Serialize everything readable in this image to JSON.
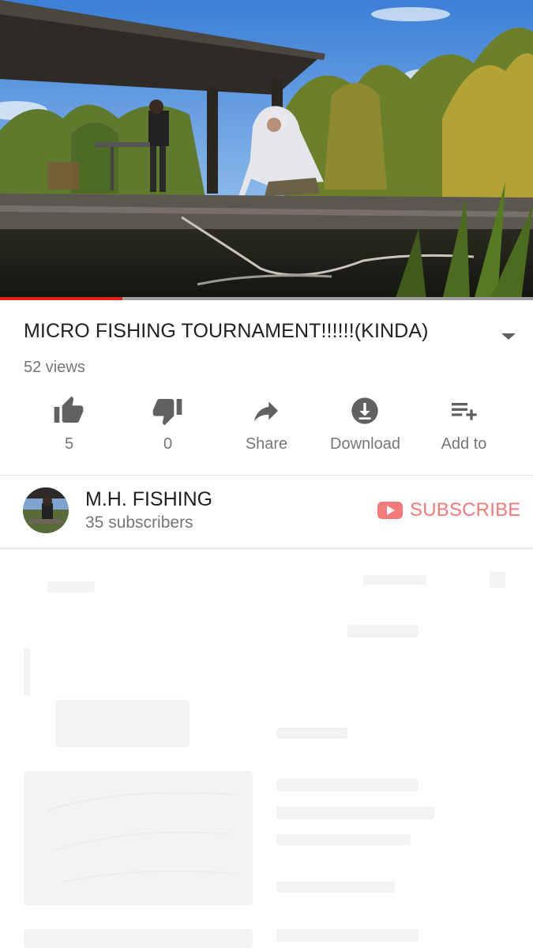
{
  "video": {
    "title": "MICRO FISHING TOURNAMENT!!!!!!(KINDA)",
    "views": "52 views",
    "progress": 0.23
  },
  "actions": [
    {
      "name": "like",
      "icon": "thumbs-up-icon",
      "label": "5"
    },
    {
      "name": "dislike",
      "icon": "thumbs-down-icon",
      "label": "0"
    },
    {
      "name": "share",
      "icon": "share-arrow-icon",
      "label": "Share"
    },
    {
      "name": "download",
      "icon": "download-icon",
      "label": "Download"
    },
    {
      "name": "add-to",
      "icon": "playlist-add-icon",
      "label": "Add to"
    }
  ],
  "channel": {
    "name": "M.H. FISHING",
    "subscribers": "35 subscribers",
    "subscribe_label": "SUBSCRIBE"
  },
  "colors": {
    "progress": "#e62117",
    "subscribe": "#f4797a",
    "icon": "#616161",
    "secondary_text": "#767676"
  }
}
